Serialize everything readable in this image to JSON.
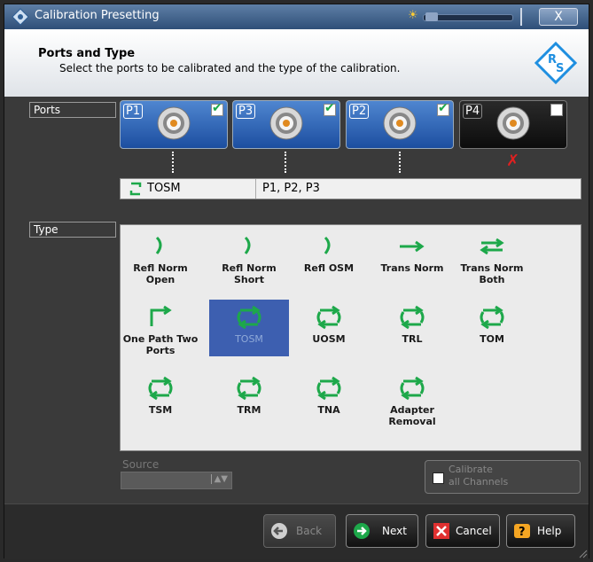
{
  "window": {
    "title": "Calibration Presetting",
    "close_label": "X"
  },
  "header": {
    "title": "Ports and Type",
    "subtitle": "Select the ports to be calibrated and the type of the calibration.",
    "logo": "R&S"
  },
  "ports": {
    "label": "Ports",
    "items": [
      {
        "label": "P1",
        "checked": true
      },
      {
        "label": "P3",
        "checked": true
      },
      {
        "label": "P2",
        "checked": true
      },
      {
        "label": "P4",
        "checked": false
      }
    ]
  },
  "summary": {
    "type": "TOSM",
    "ports": "P1, P2, P3"
  },
  "type": {
    "label": "Type",
    "options": [
      {
        "label": "Refl Norm Open"
      },
      {
        "label": "Refl Norm Short"
      },
      {
        "label": "Refl OSM"
      },
      {
        "label": "Trans Norm"
      },
      {
        "label": "Trans Norm Both"
      },
      {
        "label": "One Path Two Ports"
      },
      {
        "label": "TOSM",
        "selected": true
      },
      {
        "label": "UOSM"
      },
      {
        "label": "TRL"
      },
      {
        "label": "TOM"
      },
      {
        "label": "TSM"
      },
      {
        "label": "TRM"
      },
      {
        "label": "TNA"
      },
      {
        "label": "Adapter Removal"
      }
    ]
  },
  "source": {
    "label": "Source",
    "value": ""
  },
  "calibrate_all": {
    "label_line1": "Calibrate",
    "label_line2": "all Channels",
    "checked": false
  },
  "buttons": {
    "back": "Back",
    "next": "Next",
    "cancel": "Cancel",
    "help": "Help"
  },
  "colors": {
    "accent": "#1da84a",
    "selected": "#3d5fb0",
    "port_active": "#2a63b8",
    "error": "#e02020"
  }
}
